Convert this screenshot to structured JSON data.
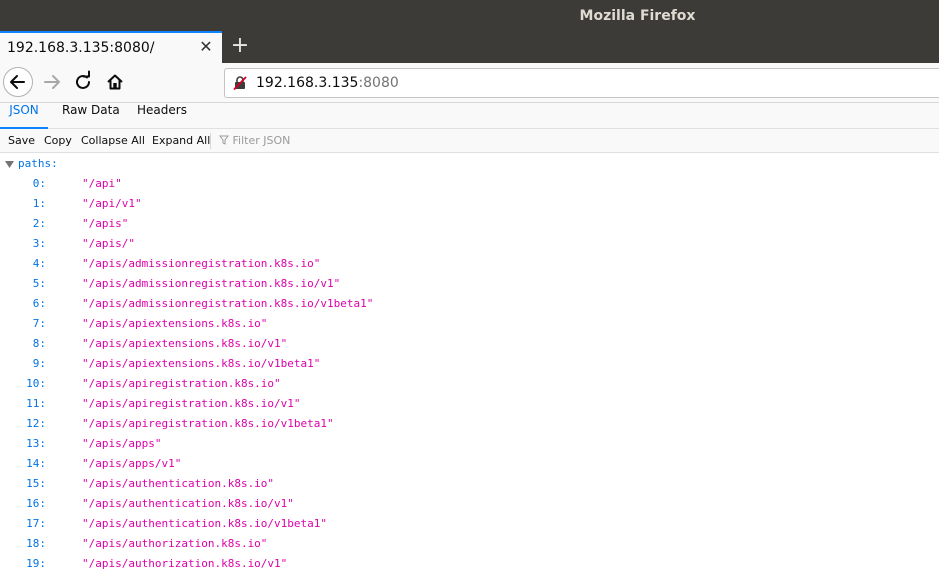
{
  "window": {
    "title": "Mozilla Firefox"
  },
  "tab": {
    "title": "192.168.3.135:8080/",
    "close": "✕",
    "new_tab": "+"
  },
  "url": {
    "host": "192.168.3.135",
    "port": ":8080"
  },
  "viewer_tabs": [
    "JSON",
    "Raw Data",
    "Headers"
  ],
  "toolbar": {
    "save": "Save",
    "copy": "Copy",
    "collapse_all": "Collapse All",
    "expand_all": "Expand All",
    "filter_placeholder": "Filter JSON"
  },
  "json": {
    "root_key": "paths:",
    "items": [
      {
        "key": "0:",
        "value": "\"/api\""
      },
      {
        "key": "1:",
        "value": "\"/api/v1\""
      },
      {
        "key": "2:",
        "value": "\"/apis\""
      },
      {
        "key": "3:",
        "value": "\"/apis/\""
      },
      {
        "key": "4:",
        "value": "\"/apis/admissionregistration.k8s.io\""
      },
      {
        "key": "5:",
        "value": "\"/apis/admissionregistration.k8s.io/v1\""
      },
      {
        "key": "6:",
        "value": "\"/apis/admissionregistration.k8s.io/v1beta1\""
      },
      {
        "key": "7:",
        "value": "\"/apis/apiextensions.k8s.io\""
      },
      {
        "key": "8:",
        "value": "\"/apis/apiextensions.k8s.io/v1\""
      },
      {
        "key": "9:",
        "value": "\"/apis/apiextensions.k8s.io/v1beta1\""
      },
      {
        "key": "10:",
        "value": "\"/apis/apiregistration.k8s.io\""
      },
      {
        "key": "11:",
        "value": "\"/apis/apiregistration.k8s.io/v1\""
      },
      {
        "key": "12:",
        "value": "\"/apis/apiregistration.k8s.io/v1beta1\""
      },
      {
        "key": "13:",
        "value": "\"/apis/apps\""
      },
      {
        "key": "14:",
        "value": "\"/apis/apps/v1\""
      },
      {
        "key": "15:",
        "value": "\"/apis/authentication.k8s.io\""
      },
      {
        "key": "16:",
        "value": "\"/apis/authentication.k8s.io/v1\""
      },
      {
        "key": "17:",
        "value": "\"/apis/authentication.k8s.io/v1beta1\""
      },
      {
        "key": "18:",
        "value": "\"/apis/authorization.k8s.io\""
      },
      {
        "key": "19:",
        "value": "\"/apis/authorization.k8s.io/v1\""
      }
    ]
  },
  "icons": {
    "back": "back-arrow-icon",
    "forward": "forward-arrow-icon",
    "reload": "reload-icon",
    "home": "home-icon",
    "insecure": "insecure-lock-icon",
    "filter": "filter-icon",
    "expand": "triangle-down-icon"
  },
  "colors": {
    "key": "#0074e8",
    "string": "#dd00a9",
    "titlebar": "#3c3b37",
    "accent": "#0a84ff"
  }
}
